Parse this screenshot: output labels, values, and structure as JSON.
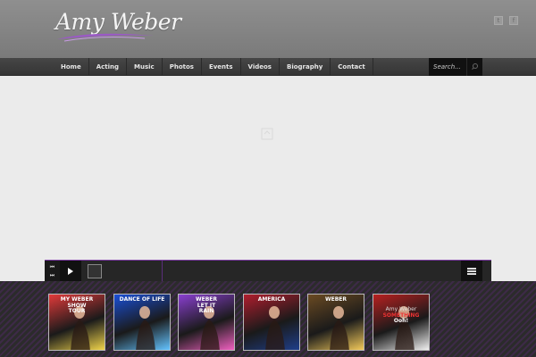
{
  "brand": {
    "logo_text": "Amy Weber"
  },
  "social": {
    "twitter_icon": "twitter-icon",
    "facebook_icon": "facebook-icon"
  },
  "nav": {
    "items": [
      {
        "label": "Home"
      },
      {
        "label": "Acting"
      },
      {
        "label": "Music"
      },
      {
        "label": "Photos"
      },
      {
        "label": "Events"
      },
      {
        "label": "Videos"
      },
      {
        "label": "Biography"
      },
      {
        "label": "Contact"
      }
    ],
    "search_placeholder": "Search..."
  },
  "player": {
    "accent": "#7b3ca3"
  },
  "albums": [
    {
      "title_lines": [
        "MY WEBER",
        "SHOW",
        "TOUR"
      ],
      "colors": [
        "#e23a3a",
        "#f0d44a"
      ]
    },
    {
      "title_lines": [
        "DANCE OF LIFE"
      ],
      "colors": [
        "#1a4fd6",
        "#63c3ff"
      ]
    },
    {
      "title_lines": [
        "WEBER",
        "LET IT",
        "RAIN"
      ],
      "colors": [
        "#8a3fd0",
        "#f060c0"
      ]
    },
    {
      "title_lines": [
        "AMERICA"
      ],
      "colors": [
        "#b01e2e",
        "#1f3e8a"
      ]
    },
    {
      "title_lines": [
        "WEBER"
      ],
      "colors": [
        "#6a4a22",
        "#f2c95a"
      ]
    },
    {
      "title_lines": [
        "Amy Weber",
        "SOMETHING",
        "Ooh!"
      ],
      "colors": [
        "#b82020",
        "#f0f0f0"
      ]
    }
  ]
}
